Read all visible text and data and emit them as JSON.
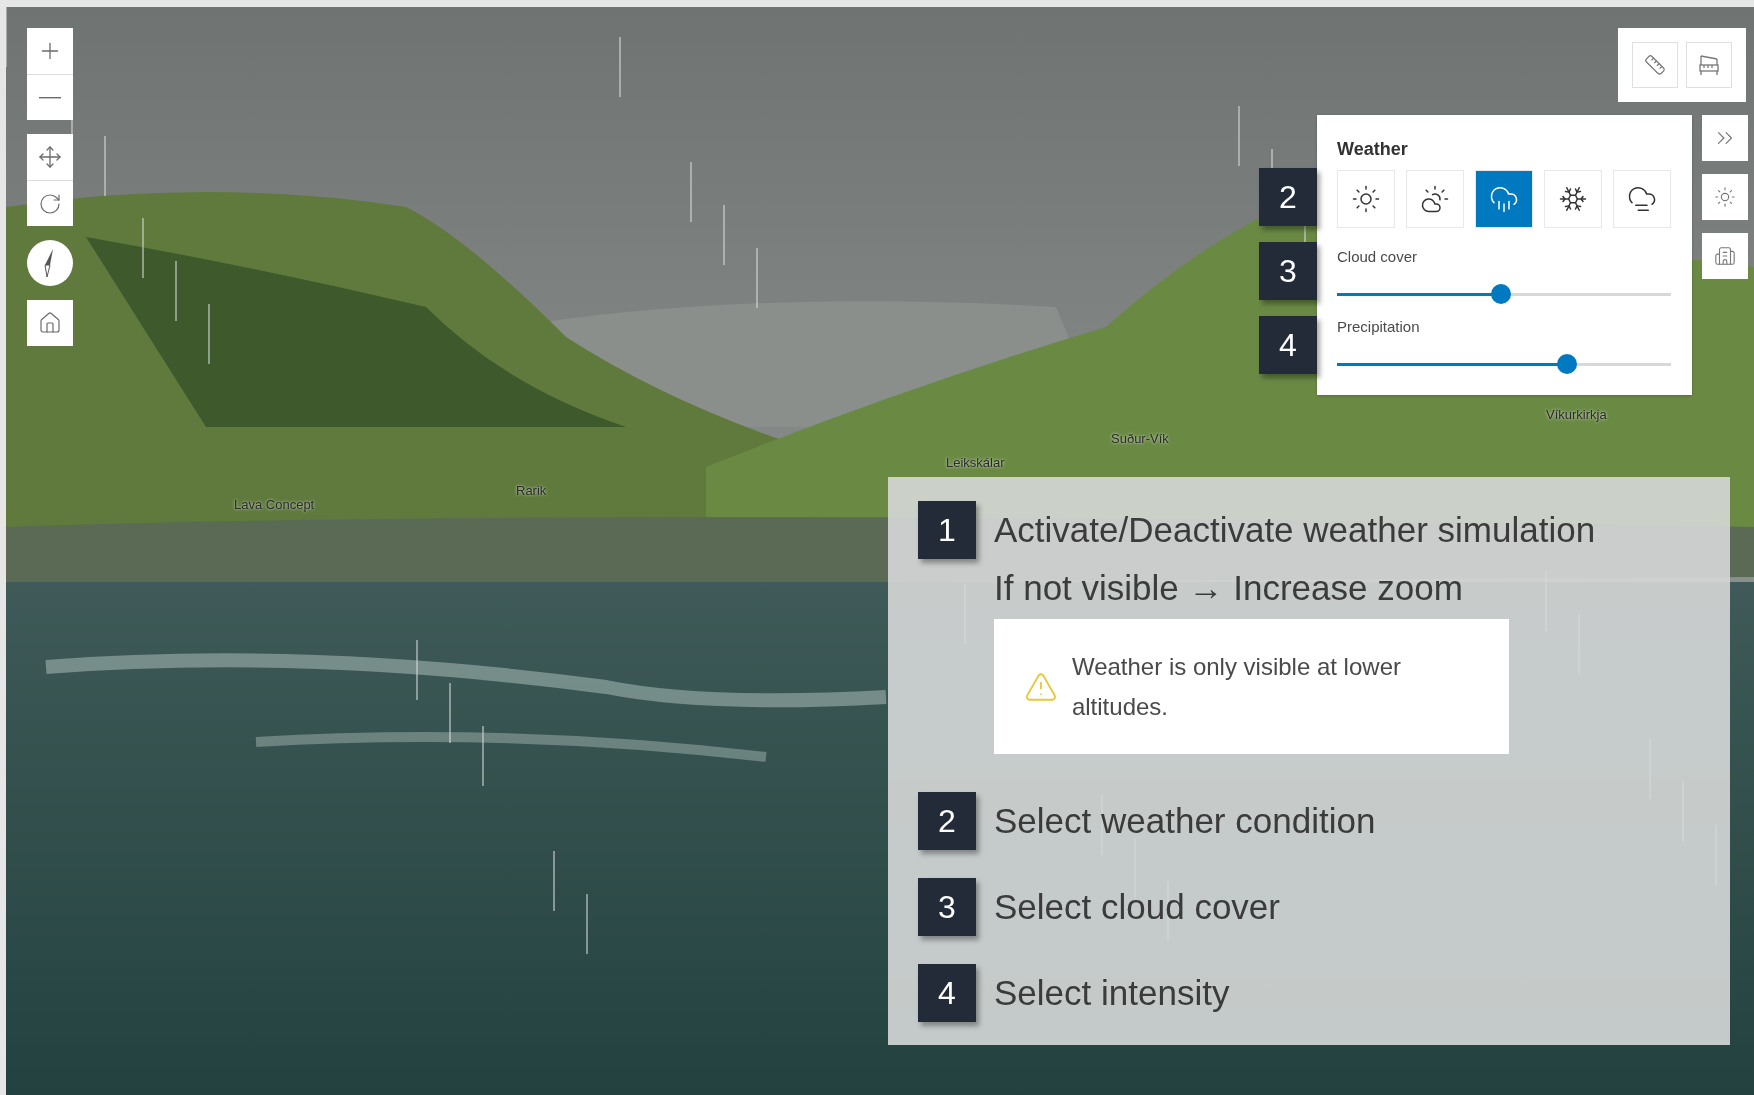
{
  "map_labels": [
    {
      "text": "Lava Concept"
    },
    {
      "text": "Rarik"
    },
    {
      "text": "Leikskálar"
    },
    {
      "text": "Suður-Vík"
    },
    {
      "text": "Víkurkirkja"
    }
  ],
  "weather_panel": {
    "title": "Weather",
    "conditions": [
      {
        "kind": "sunny",
        "selected": false
      },
      {
        "kind": "cloudy",
        "selected": false
      },
      {
        "kind": "rainy",
        "selected": true
      },
      {
        "kind": "snowy",
        "selected": false
      },
      {
        "kind": "foggy",
        "selected": false
      }
    ],
    "sliders": [
      {
        "label": "Cloud cover",
        "level": 0.49
      },
      {
        "label": "Precipitation",
        "level": 0.69
      }
    ]
  },
  "panel_callouts": [
    "2",
    "3",
    "4"
  ],
  "instructions": [
    {
      "number": "1",
      "text": "Activate/Deactivate weather simulation",
      "note": "If not visible → Increase zoom",
      "warning": "Weather is only visible at lower altitudes."
    },
    {
      "number": "2",
      "text": "Select weather condition"
    },
    {
      "number": "3",
      "text": "Select cloud cover"
    },
    {
      "number": "4",
      "text": "Select intensity"
    }
  ]
}
